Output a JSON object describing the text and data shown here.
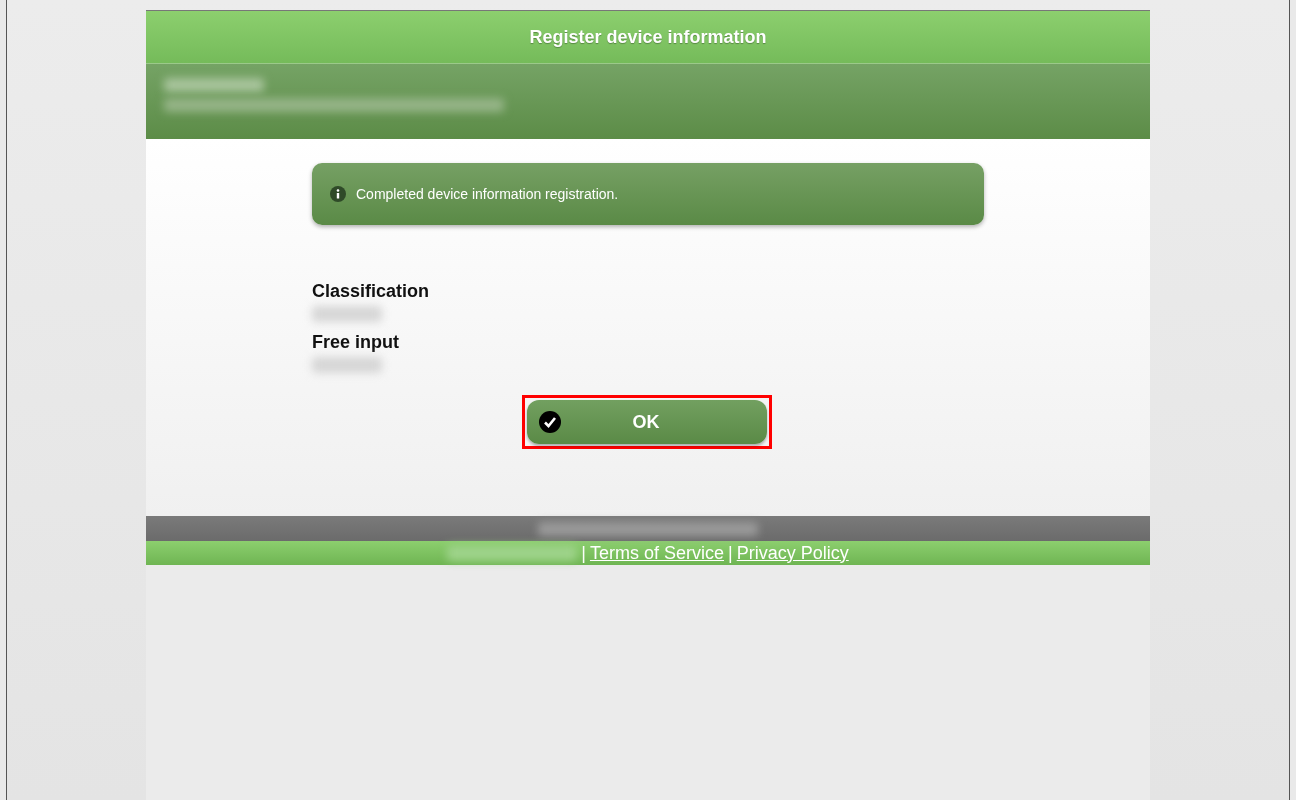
{
  "header": {
    "title": "Register device information"
  },
  "message": {
    "text": "Completed device information registration."
  },
  "fields": [
    {
      "label": "Classification"
    },
    {
      "label": "Free input"
    }
  ],
  "ok_button": {
    "label": "OK",
    "highlighted": true
  },
  "footer": {
    "links": [
      {
        "separator": "|",
        "label": "Terms of Service"
      },
      {
        "separator": "|",
        "label": "Privacy Policy"
      }
    ]
  }
}
